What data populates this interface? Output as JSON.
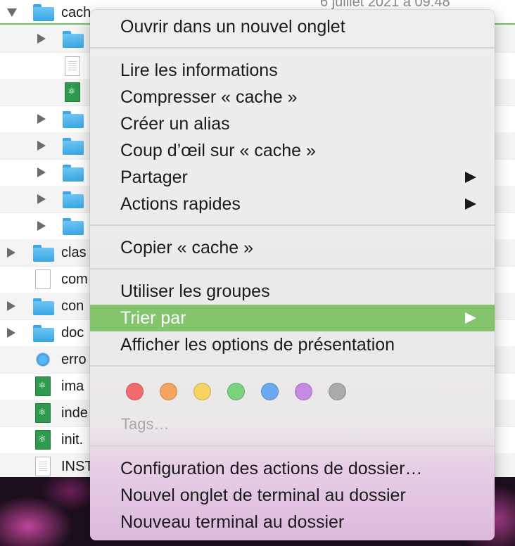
{
  "finder": {
    "rows": [
      {
        "name": "cach",
        "date": "6 juillet 2021 à 09:48"
      },
      {
        "name": ""
      },
      {
        "name": ""
      },
      {
        "name": ""
      },
      {
        "name": ""
      },
      {
        "name": ""
      },
      {
        "name": ""
      },
      {
        "name": ""
      },
      {
        "name": ""
      },
      {
        "name": "clas"
      },
      {
        "name": "com"
      },
      {
        "name": "con"
      },
      {
        "name": "doc"
      },
      {
        "name": "erro"
      },
      {
        "name": "ima"
      },
      {
        "name": "inde"
      },
      {
        "name": "init."
      },
      {
        "name": "INST"
      }
    ]
  },
  "menu": {
    "open_new_tab": "Ouvrir dans un nouvel onglet",
    "get_info": "Lire les informations",
    "compress": "Compresser « cache »",
    "make_alias": "Créer un alias",
    "quick_look": "Coup d’œil sur « cache »",
    "share": "Partager",
    "quick_actions": "Actions rapides",
    "copy": "Copier « cache »",
    "use_groups": "Utiliser les groupes",
    "sort_by": "Trier par",
    "view_options": "Afficher les options de présentation",
    "tags": "Tags…",
    "folder_actions": "Configuration des actions de dossier…",
    "new_terminal_tab": "Nouvel onglet de terminal au dossier",
    "new_terminal": "Nouveau terminal au dossier"
  },
  "tag_colors": [
    {
      "name": "red",
      "color": "#f36a6d"
    },
    {
      "name": "orange",
      "color": "#f5a55e"
    },
    {
      "name": "yellow",
      "color": "#f5d463"
    },
    {
      "name": "green",
      "color": "#7bd27d"
    },
    {
      "name": "blue",
      "color": "#6aa8f0"
    },
    {
      "name": "purple",
      "color": "#c68ae0"
    },
    {
      "name": "gray",
      "color": "#ababab"
    }
  ],
  "colors": {
    "highlight": "#84c46d",
    "selection_line": "#6cc35a"
  }
}
